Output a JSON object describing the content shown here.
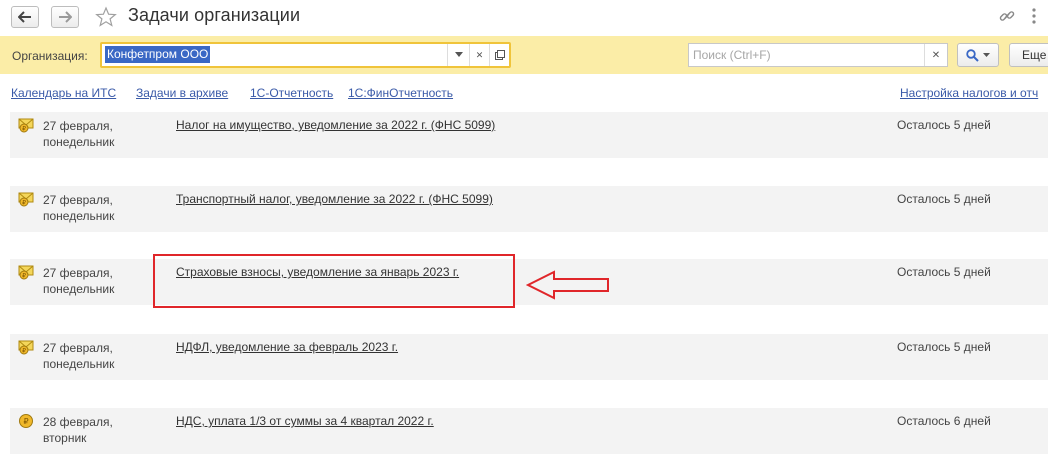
{
  "window": {
    "title": "Задачи организации"
  },
  "filter": {
    "org_label": "Организация:",
    "org_value": "Конфетпром ООО",
    "search_placeholder": "Поиск (Ctrl+F)",
    "more_label": "Еще"
  },
  "links": [
    {
      "label": "Календарь на ИТС"
    },
    {
      "label": "Задачи в архиве"
    },
    {
      "label": "1С-Отчетность"
    },
    {
      "label": "1С:ФинОтчетность"
    }
  ],
  "tax_settings_link": "Настройка налогов и отч",
  "tasks": [
    {
      "icon": "envelope-coin-icon",
      "date_line1": "27 февраля,",
      "date_line2": "понедельник",
      "name": "Налог на имущество, уведомление за 2022 г. (ФНС 5099)",
      "remaining": "Осталось 5 дней"
    },
    {
      "icon": "envelope-coin-icon",
      "date_line1": "27 февраля,",
      "date_line2": "понедельник",
      "name": "Транспортный налог, уведомление за 2022 г. (ФНС 5099)",
      "remaining": "Осталось 5 дней"
    },
    {
      "icon": "envelope-coin-icon",
      "date_line1": "27 февраля,",
      "date_line2": "понедельник",
      "name": "Страховые взносы, уведомление за январь 2023 г.",
      "remaining": "Осталось 5 дней"
    },
    {
      "icon": "envelope-coin-icon",
      "date_line1": "27 февраля,",
      "date_line2": "понедельник",
      "name": "НДФЛ, уведомление за февраль 2023 г.",
      "remaining": "Осталось 5 дней"
    },
    {
      "icon": "ruble-coin-icon",
      "date_line1": "28 февраля,",
      "date_line2": "вторник",
      "name": "НДС, уплата 1/3 от суммы за 4 квартал 2022 г.",
      "remaining": "Осталось 6 дней"
    }
  ],
  "colors": {
    "filter_bg": "#fbeda7",
    "link": "#3a5aa8",
    "selection": "#3a68c5",
    "highlight": "#e0262a",
    "row_bg": "#f3f3f3"
  }
}
